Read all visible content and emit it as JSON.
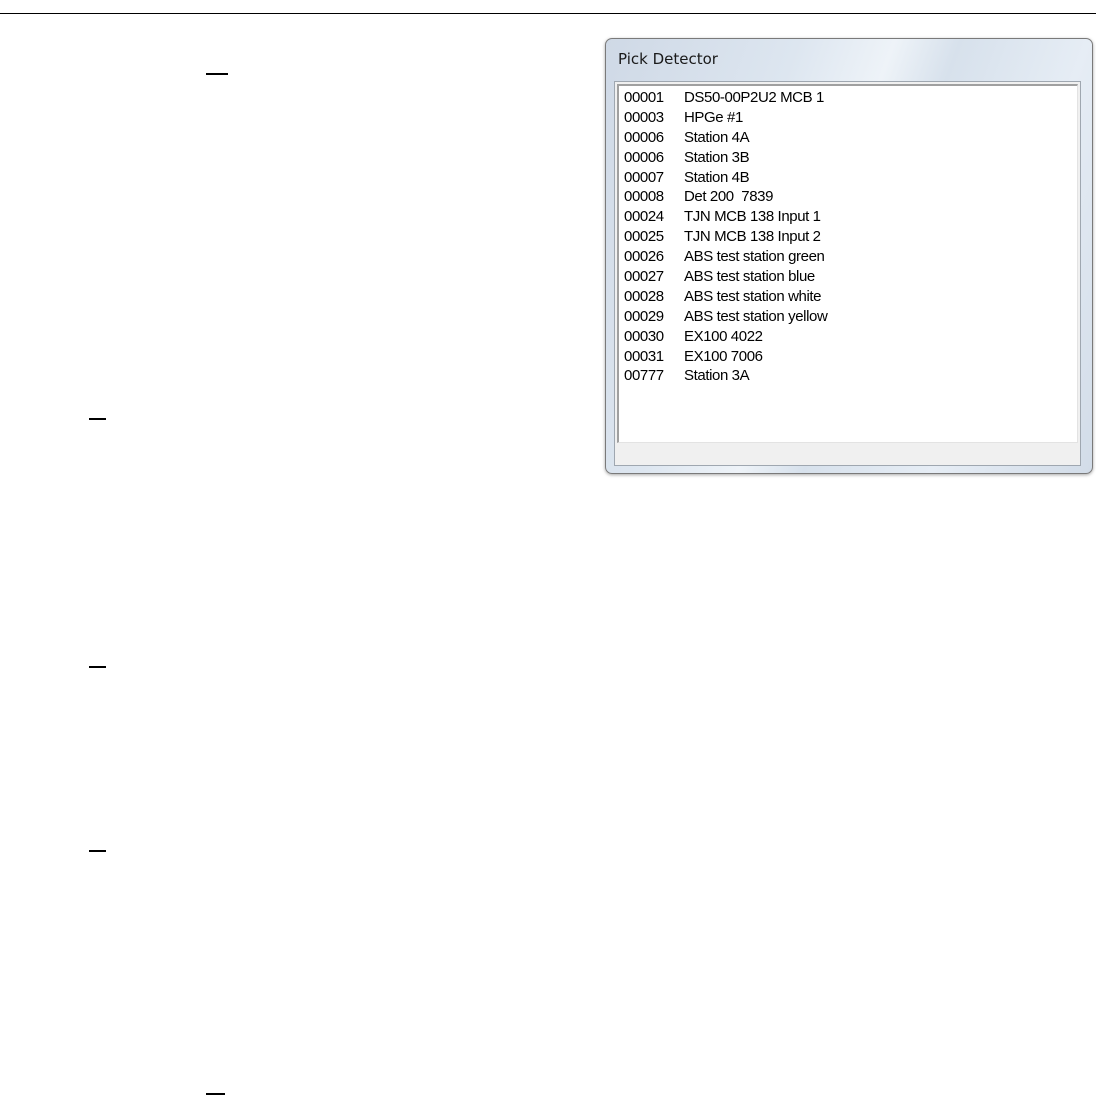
{
  "dialog": {
    "title": "Pick Detector",
    "detectors": [
      {
        "id": "00001",
        "name": "DS50-00P2U2 MCB 1"
      },
      {
        "id": "00003",
        "name": "HPGe #1"
      },
      {
        "id": "00006",
        "name": "Station 4A"
      },
      {
        "id": "00006",
        "name": "Station 3B"
      },
      {
        "id": "00007",
        "name": "Station 4B"
      },
      {
        "id": "00008",
        "name": "Det 200  7839"
      },
      {
        "id": "00024",
        "name": "TJN MCB 138 Input 1"
      },
      {
        "id": "00025",
        "name": "TJN MCB 138 Input 2"
      },
      {
        "id": "00026",
        "name": "ABS test station green"
      },
      {
        "id": "00027",
        "name": "ABS test station blue"
      },
      {
        "id": "00028",
        "name": "ABS test station white"
      },
      {
        "id": "00029",
        "name": "ABS test station yellow"
      },
      {
        "id": "00030",
        "name": "EX100 4022"
      },
      {
        "id": "00031",
        "name": "EX100 7006"
      },
      {
        "id": "00777",
        "name": "Station 3A"
      }
    ]
  }
}
